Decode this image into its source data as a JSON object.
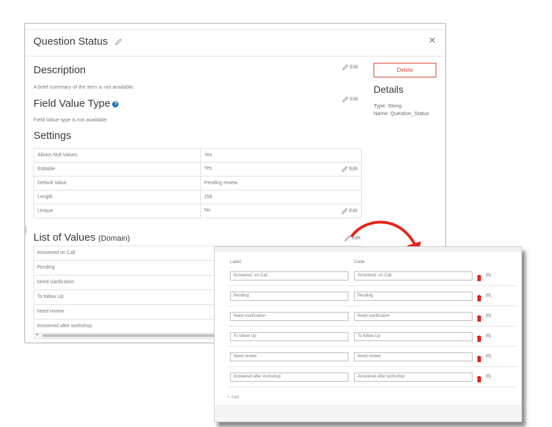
{
  "header": {
    "title": "Question Status",
    "close_glyph": "×"
  },
  "description": {
    "title": "Description",
    "text": "A brief summary of the item is not available.",
    "edit_label": "Edit"
  },
  "field_value_type": {
    "title": "Field Value Type",
    "help_glyph": "?",
    "text": "Field Value type is not available.",
    "edit_label": "Edit"
  },
  "sidebar": {
    "delete_label": "Delete",
    "details_title": "Details",
    "type_line": "Type: String",
    "name_line": "Name: Question_Status"
  },
  "settings": {
    "title": "Settings",
    "rows": [
      {
        "label": "Allows Null Values",
        "value": "Yes",
        "edit": ""
      },
      {
        "label": "Editable",
        "value": "Yes",
        "edit": "Edit"
      },
      {
        "label": "Default Value",
        "value": "Pending review",
        "edit": ""
      },
      {
        "label": "Length",
        "value": "256",
        "edit": ""
      },
      {
        "label": "Unique",
        "value": "No",
        "edit": "Edit"
      }
    ]
  },
  "domain": {
    "title": "List of Values",
    "subtitle": "(Domain)",
    "edit_label": "Edit",
    "items": [
      "Answered on Call",
      "Pending",
      "Need clarification",
      "To follow Up",
      "Need review",
      "Answered after workshop"
    ]
  },
  "zoom": {
    "label_header": "Label",
    "code_header": "Code",
    "rows": [
      {
        "label": "Answered  on Call",
        "code": "Answered  on Call",
        "count": "(0)"
      },
      {
        "label": "Pending",
        "code": "Pending",
        "count": "(0)"
      },
      {
        "label": "Need clarification",
        "code": "Need clarification",
        "count": "(0)"
      },
      {
        "label": "To follow Up",
        "code": "To follow Up",
        "count": "(0)"
      },
      {
        "label": "Need review",
        "code": "Need review",
        "count": "(0)"
      },
      {
        "label": "Answered after workshop",
        "code": "Answered after workshop",
        "count": "(0)"
      }
    ],
    "add_label": "+ Add"
  },
  "colors": {
    "accent_red": "#d8473a",
    "arrow_red": "#e4231b",
    "help_blue": "#1b6fc0"
  }
}
